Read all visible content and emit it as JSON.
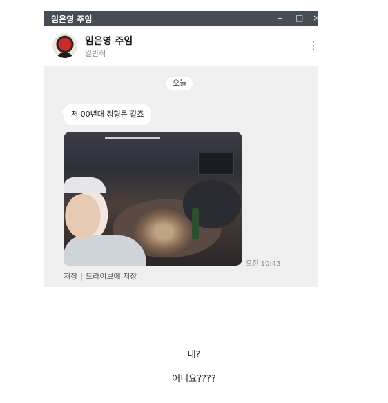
{
  "window": {
    "title": "임은영 주임",
    "controls": {
      "minimize": "‒",
      "maximize": "□",
      "close": "×"
    }
  },
  "header": {
    "name": "임은영 주임",
    "subtitle": "일반직",
    "more_icon": "⋮"
  },
  "chat": {
    "date_label": "오늘",
    "message_text": "저 00년대 정형돈 같죠",
    "photo_time": "오전 10:43",
    "save_label": "저장",
    "separator": "|",
    "drive_save_label": "드라이브에 저장"
  },
  "captions": {
    "line1": "네?",
    "line2": "어디요????"
  }
}
